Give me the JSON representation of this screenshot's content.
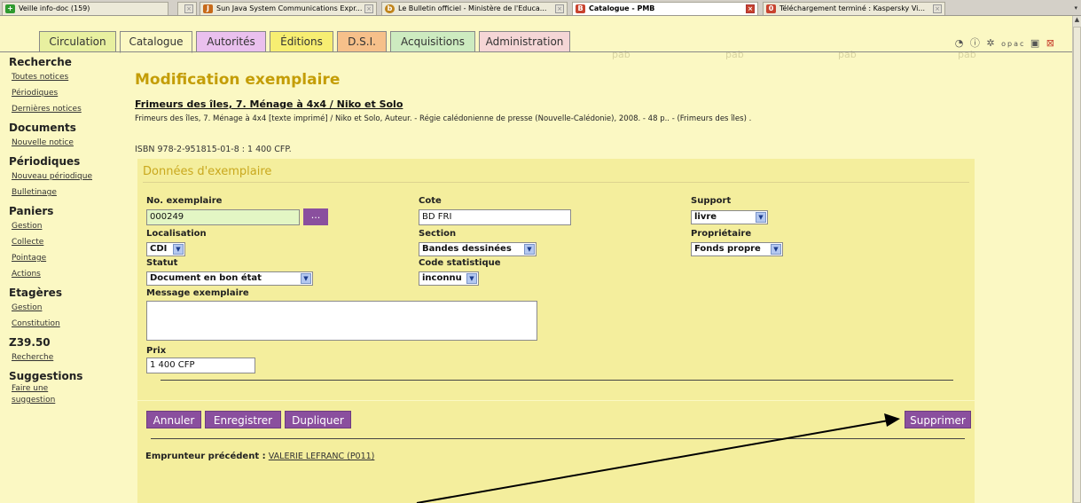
{
  "browser_tabs": [
    {
      "label": "Veille info-doc (159)",
      "icon": "plus-icon",
      "color": "#2f9a2f",
      "active": false
    },
    {
      "label": "Sun Java System Communications Expr...",
      "icon": "java-icon",
      "color": "#c76a1a",
      "active": false
    },
    {
      "label": "Le Bulletin officiel - Ministère de l'Educa...",
      "icon": "bulletin-icon",
      "color": "#c0841c",
      "active": false
    },
    {
      "label": "Catalogue - PMB",
      "icon": "pmb-icon",
      "color": "#c8432f",
      "active": true
    },
    {
      "label": "Téléchargement terminé : Kaspersky Vi...",
      "icon": "kaspersky-icon",
      "color": "#c8432f",
      "active": false
    }
  ],
  "nav": {
    "tabs": [
      {
        "label": "Circulation",
        "color": "#e8f0a0"
      },
      {
        "label": "Catalogue",
        "color": "#fbf8c3"
      },
      {
        "label": "Autorités",
        "color": "#eac0ee"
      },
      {
        "label": "Éditions",
        "color": "#f7ee72"
      },
      {
        "label": "D.S.I.",
        "color": "#f6c08a"
      },
      {
        "label": "Acquisitions",
        "color": "#cdebc0"
      },
      {
        "label": "Administration",
        "color": "#f5d6d6"
      }
    ],
    "ghost_labels": [
      "pab",
      "pab",
      "pab",
      "pab"
    ],
    "tools": [
      "history-icon",
      "help-icon",
      "gear-icon",
      "opac-icon",
      "save-icon",
      "close-icon"
    ],
    "tools_opac_label": "opac"
  },
  "sidebar": [
    {
      "title": "Recherche",
      "links": [
        "Toutes notices",
        "Périodiques",
        "Dernières notices"
      ]
    },
    {
      "title": "Documents",
      "links": [
        "Nouvelle notice"
      ]
    },
    {
      "title": "Périodiques",
      "links": [
        "Nouveau périodique",
        "Bulletinage"
      ]
    },
    {
      "title": "Paniers",
      "links": [
        "Gestion",
        "Collecte",
        "Pointage",
        "Actions"
      ]
    },
    {
      "title": "Etagères",
      "links": [
        "Gestion",
        "Constitution"
      ]
    },
    {
      "title": "Z39.50",
      "links": [
        "Recherche"
      ]
    },
    {
      "title": "Suggestions",
      "links": [
        "Faire une",
        "suggestion"
      ]
    }
  ],
  "main": {
    "page_title": "Modification exemplaire",
    "notice_title": "Frimeurs des îles, 7. Ménage à 4x4 / Niko et Solo",
    "notice_desc": "Frimeurs des îles, 7. Ménage à 4x4 [texte imprimé] / Niko et Solo, Auteur. - Régie calédonienne de presse (Nouvelle-Calédonie), 2008. - 48 p.. - (Frimeurs des îles) .",
    "isbn": "ISBN 978-2-951815-01-8 : 1 400 CFP.",
    "panel_title": "Données d'exemplaire",
    "fields": {
      "no_exemplaire": {
        "label": "No. exemplaire",
        "value": "000249",
        "button": "..."
      },
      "cote": {
        "label": "Cote",
        "value": "BD FRI"
      },
      "support": {
        "label": "Support",
        "value": "livre"
      },
      "localisation": {
        "label": "Localisation",
        "value": "CDI"
      },
      "section": {
        "label": "Section",
        "value": "Bandes dessinées"
      },
      "proprietaire": {
        "label": "Propriétaire",
        "value": "Fonds propre"
      },
      "statut": {
        "label": "Statut",
        "value": "Document en bon état"
      },
      "code_statistique": {
        "label": "Code statistique",
        "value": "inconnu"
      },
      "message": {
        "label": "Message exemplaire",
        "value": ""
      },
      "prix": {
        "label": "Prix",
        "value": "1 400 CFP"
      }
    },
    "buttons": {
      "annuler": "Annuler",
      "enregistrer": "Enregistrer",
      "dupliquer": "Dupliquer",
      "supprimer": "Supprimer"
    },
    "emprunteur_label": "Emprunteur précédent :",
    "emprunteur_value": "VALERIE LEFRANC (P011)"
  }
}
